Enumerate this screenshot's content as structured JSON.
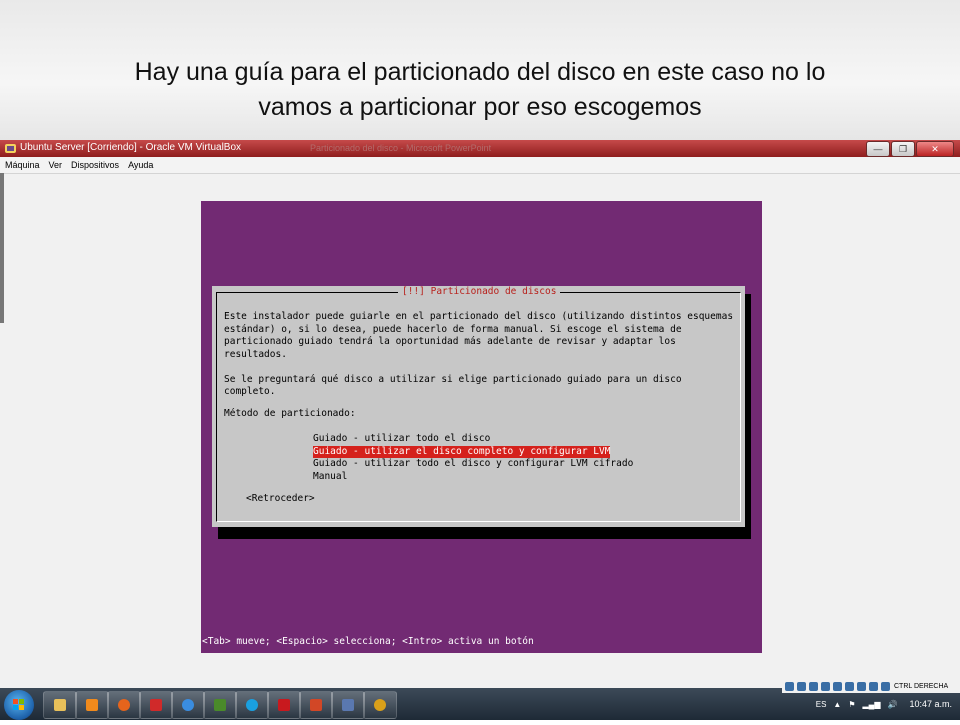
{
  "caption": {
    "line1": "Hay una guía para el particionado del disco en este caso no lo",
    "line2": "vamos a particionar por eso escogemos"
  },
  "window": {
    "title": "Ubuntu Server [Corriendo] - Oracle VM VirtualBox",
    "faint_title": "Particionado del disco - Microsoft PowerPoint",
    "buttons": [
      "minimize",
      "restore",
      "close"
    ],
    "title_color": "#8e1d1d"
  },
  "menu": [
    {
      "label": "Máquina"
    },
    {
      "label": "Ver"
    },
    {
      "label": "Dispositivos"
    },
    {
      "label": "Ayuda"
    }
  ],
  "installer": {
    "bg_color": "#722a73",
    "dialog_title": "[!!] Particionado de discos",
    "lines": [
      "Este instalador puede guiarle en el particionado del disco (utilizando distintos esquemas",
      "estándar) o, si lo desea, puede hacerlo de forma manual. Si escoge el sistema de",
      "particionado guiado tendrá la oportunidad más adelante de revisar y adaptar los",
      "resultados.",
      "",
      "Se le preguntará qué disco a utilizar si elige particionado guiado para un disco",
      "completo.",
      "",
      "Método de particionado:"
    ],
    "options": [
      {
        "label": "Guiado - utilizar todo el disco",
        "selected": false
      },
      {
        "label": "Guiado - utilizar el disco completo y configurar LVM",
        "selected": true
      },
      {
        "label": "Guiado - utilizar todo el disco y configurar LVM cifrado",
        "selected": false
      },
      {
        "label": "Manual",
        "selected": false
      }
    ],
    "back_label": "<Retroceder>",
    "hint": "<Tab> mueve; <Espacio> selecciona; <Intro> activa un botón",
    "selection_color": "#d5211c",
    "title_color": "#b8211c"
  },
  "taskbar": {
    "apps": [
      {
        "icon": "folder-icon",
        "color": "#e8c05a"
      },
      {
        "icon": "media-player-icon",
        "color": "#f08a1c"
      },
      {
        "icon": "firefox-icon",
        "color": "#e5641c"
      },
      {
        "icon": "foxit-icon",
        "color": "#d02a2a"
      },
      {
        "icon": "ie-icon",
        "color": "#3a8de0"
      },
      {
        "icon": "dreamweaver-icon",
        "color": "#4a8a2a"
      },
      {
        "icon": "skype-icon",
        "color": "#1aa0e0"
      },
      {
        "icon": "acrobat-icon",
        "color": "#c8191e"
      },
      {
        "icon": "powerpoint-icon",
        "color": "#d24726"
      },
      {
        "icon": "virtualbox-icon",
        "color": "#5a78b0"
      },
      {
        "icon": "chrome-icon",
        "color": "#d9a01a"
      }
    ],
    "host_key": "CTRL DERECHA",
    "language": "ES",
    "clock": "10:47 a.m."
  }
}
